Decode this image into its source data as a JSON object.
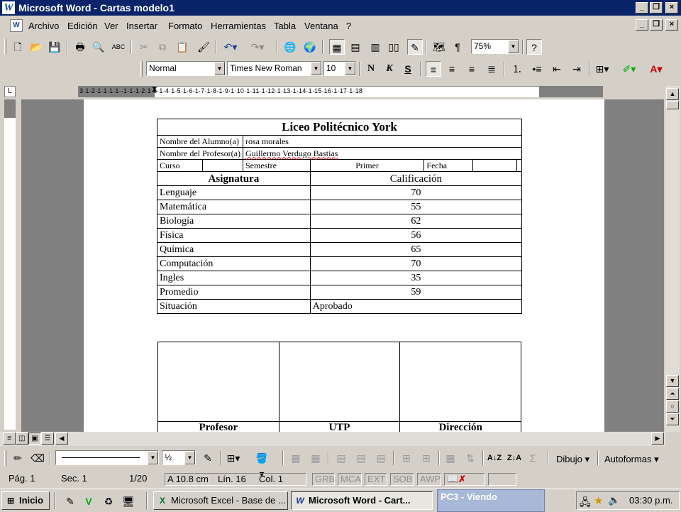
{
  "window": {
    "title": "Microsoft Word - Cartas modelo1",
    "app_icon": "word-w-icon"
  },
  "menu": [
    "Archivo",
    "Edición",
    "Ver",
    "Insertar",
    "Formato",
    "Herramientas",
    "Tabla",
    "Ventana",
    "?"
  ],
  "toolbar": {
    "zoom": "75%"
  },
  "format_toolbar": {
    "style": "Normal",
    "font": "Times New Roman",
    "size": "10"
  },
  "ruler": {
    "marks": "3·1·2·1·1·1·1··1·1·1·2·1·3·1·4·1·5·1·6·1·7·1·8·1·9·1·10·1·11·1·12·1·13·1·14·1·15·16·1·17·1·18"
  },
  "document": {
    "school": "Liceo Politécnico York",
    "student_label": "Nombre del Alumno(a)",
    "student_value": "rosa morales",
    "teacher_label": "Nombre del Profesor(a)",
    "teacher_value": "Guillermo Verdugo Bastias",
    "course_label": "Curso",
    "semester_label": "Semestre",
    "semester_value": "Primer",
    "date_label": "Fecha",
    "subject_header": "Asignatura",
    "grade_header": "Calificación",
    "rows": [
      {
        "subject": "Lenguaje",
        "grade": "70"
      },
      {
        "subject": "Matemática",
        "grade": "55"
      },
      {
        "subject": "Biología",
        "grade": "62"
      },
      {
        "subject": "Física",
        "grade": "56"
      },
      {
        "subject": "Química",
        "grade": "65"
      },
      {
        "subject": "Computación",
        "grade": "70"
      },
      {
        "subject": "Ingles",
        "grade": "35"
      },
      {
        "subject": "Promedio",
        "grade": "59"
      }
    ],
    "situation_label": "Situación",
    "situation_value": "Aprobado",
    "signatures": [
      "Profesor",
      "UTP",
      "Dirección"
    ]
  },
  "drawing": {
    "draw_label": "Dibujo",
    "autoshapes_label": "Autoformas",
    "line_width": "½"
  },
  "status": {
    "page": "Pág. 1",
    "section": "Sec. 1",
    "pages": "1/20",
    "at": "A  10.8 cm",
    "line": "Lín. 16",
    "col": "Col. 1",
    "grb": "GRB",
    "mca": "MCA",
    "ext": "EXT",
    "sob": "SOB",
    "awp": "AWP"
  },
  "taskbar": {
    "start": "Inicio",
    "tasks": [
      "Microsoft Excel - Base de ...",
      "Microsoft Word - Cart..."
    ],
    "overlay": "PC3 - Viendo",
    "clock": "03:30 p.m."
  }
}
